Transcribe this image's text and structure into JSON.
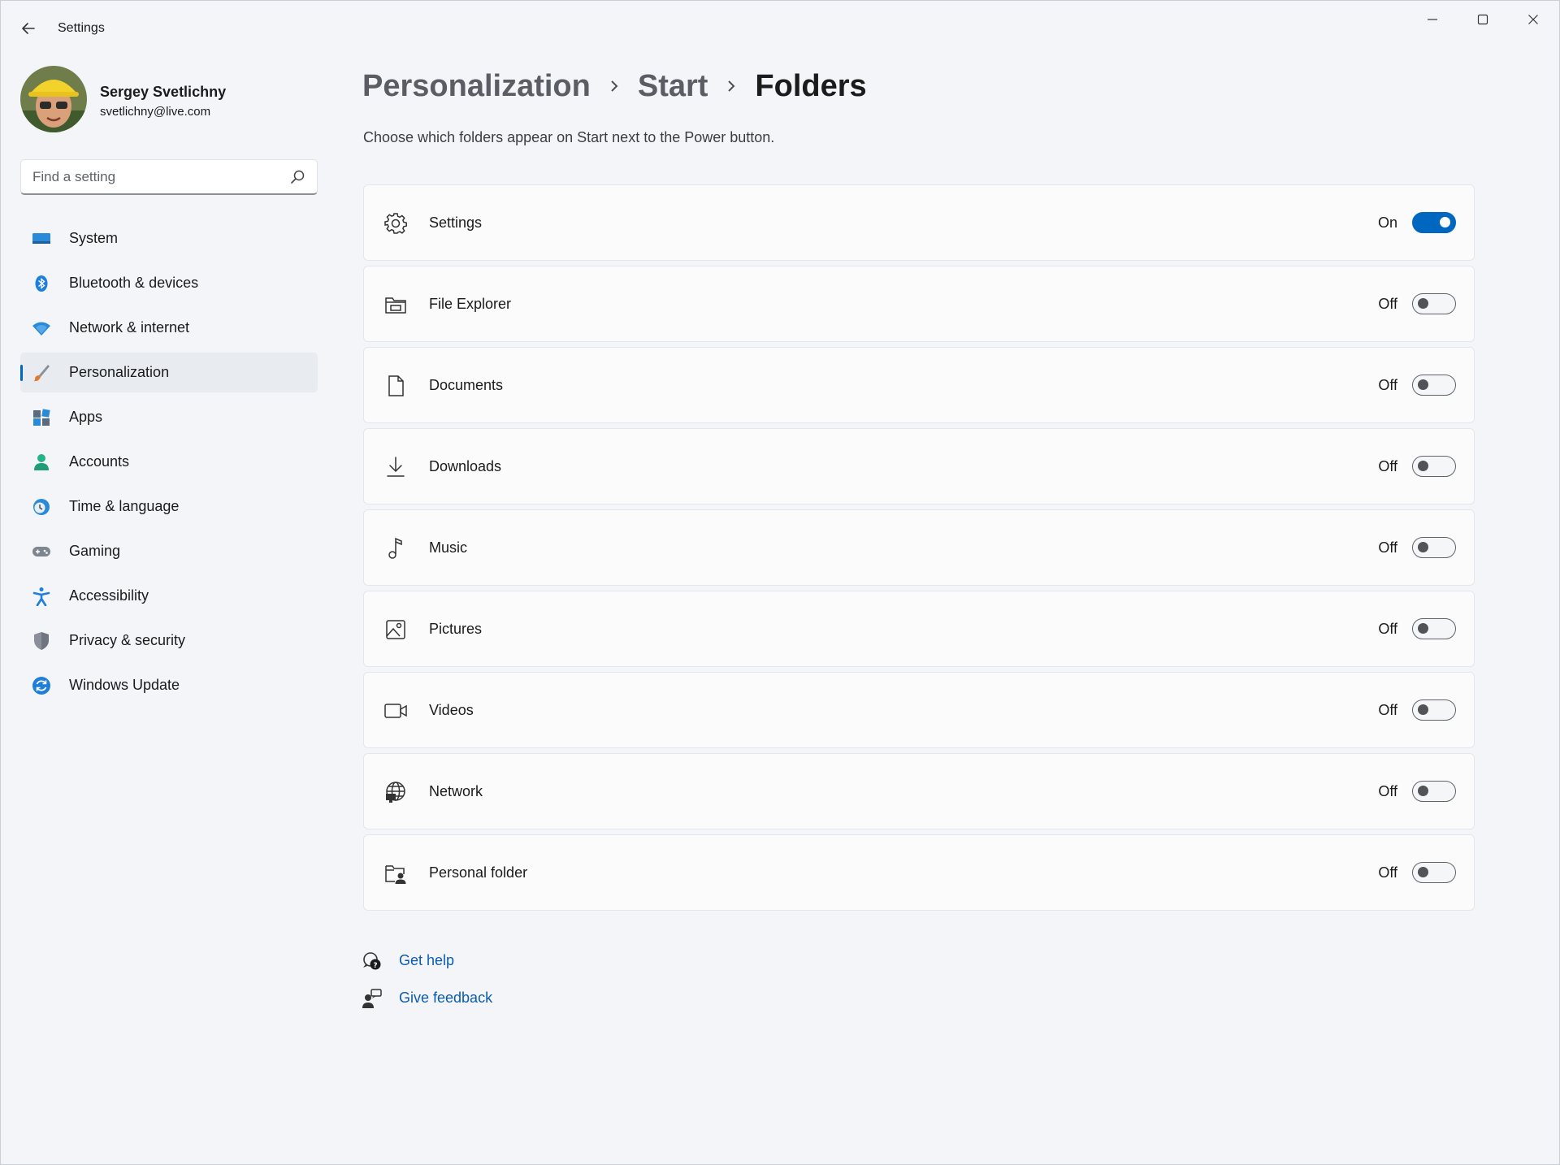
{
  "app": {
    "title": "Settings"
  },
  "profile": {
    "name": "Sergey Svetlichny",
    "email": "svetlichny@live.com"
  },
  "search": {
    "placeholder": "Find a setting"
  },
  "sidebar": {
    "items": [
      {
        "label": "System",
        "icon": "system-icon"
      },
      {
        "label": "Bluetooth & devices",
        "icon": "bluetooth-icon"
      },
      {
        "label": "Network & internet",
        "icon": "wifi-icon"
      },
      {
        "label": "Personalization",
        "icon": "brush-icon",
        "active": true
      },
      {
        "label": "Apps",
        "icon": "apps-icon"
      },
      {
        "label": "Accounts",
        "icon": "account-icon"
      },
      {
        "label": "Time & language",
        "icon": "clock-globe-icon"
      },
      {
        "label": "Gaming",
        "icon": "gamepad-icon"
      },
      {
        "label": "Accessibility",
        "icon": "accessibility-icon"
      },
      {
        "label": "Privacy & security",
        "icon": "shield-icon"
      },
      {
        "label": "Windows Update",
        "icon": "update-icon"
      }
    ]
  },
  "breadcrumb": {
    "items": [
      "Personalization",
      "Start",
      "Folders"
    ]
  },
  "main": {
    "subtitle": "Choose which folders appear on Start next to the Power button.",
    "folders": [
      {
        "label": "Settings",
        "state": "On",
        "on": true,
        "icon": "gear-icon"
      },
      {
        "label": "File Explorer",
        "state": "Off",
        "on": false,
        "icon": "file-explorer-icon"
      },
      {
        "label": "Documents",
        "state": "Off",
        "on": false,
        "icon": "document-icon"
      },
      {
        "label": "Downloads",
        "state": "Off",
        "on": false,
        "icon": "download-icon"
      },
      {
        "label": "Music",
        "state": "Off",
        "on": false,
        "icon": "music-note-icon"
      },
      {
        "label": "Pictures",
        "state": "Off",
        "on": false,
        "icon": "picture-icon"
      },
      {
        "label": "Videos",
        "state": "Off",
        "on": false,
        "icon": "video-camera-icon"
      },
      {
        "label": "Network",
        "state": "Off",
        "on": false,
        "icon": "network-globe-icon"
      },
      {
        "label": "Personal folder",
        "state": "Off",
        "on": false,
        "icon": "personal-folder-icon"
      }
    ]
  },
  "footer": {
    "get_help": "Get help",
    "give_feedback": "Give feedback"
  },
  "colors": {
    "accent": "#0067c0",
    "link": "#0b5cad"
  }
}
